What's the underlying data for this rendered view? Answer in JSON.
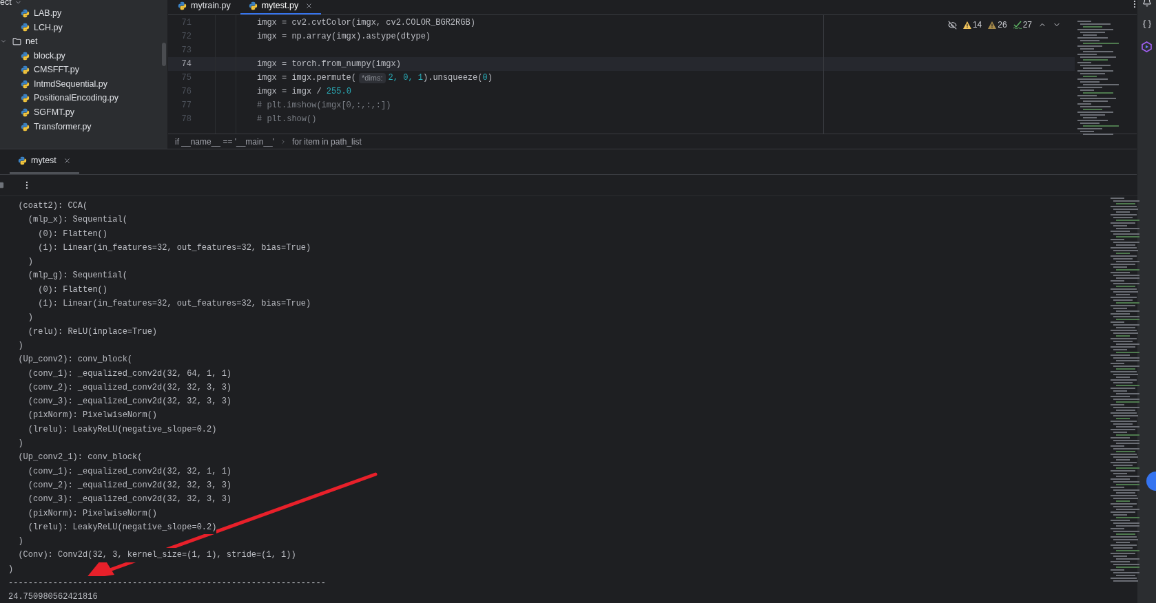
{
  "project_panel": {
    "header": "ect",
    "tree": [
      {
        "label": "LAB.py",
        "kind": "file"
      },
      {
        "label": "LCH.py",
        "kind": "file"
      },
      {
        "label": "net",
        "kind": "folder",
        "expanded": true,
        "children": [
          {
            "label": "block.py",
            "kind": "file"
          },
          {
            "label": "CMSFFT.py",
            "kind": "file"
          },
          {
            "label": "IntmdSequential.py",
            "kind": "file"
          },
          {
            "label": "PositionalEncoding.py",
            "kind": "file"
          },
          {
            "label": "SGFMT.py",
            "kind": "file"
          },
          {
            "label": "Transformer.py",
            "kind": "file"
          }
        ]
      }
    ]
  },
  "editor_tabs": [
    {
      "label": "mytrain.py",
      "selected": false
    },
    {
      "label": "mytest.py",
      "selected": true
    }
  ],
  "inspections": [
    {
      "kind": "warning",
      "count": "14"
    },
    {
      "kind": "weak_warning",
      "count": "26"
    },
    {
      "kind": "typo",
      "count": "27"
    }
  ],
  "code_lines": [
    {
      "number": "71",
      "current": false,
      "segments": [
        {
          "kind": "code",
          "text": "imgx = cv2.cvtColor(imgx, cv2.COLOR_BGR2RGB)"
        }
      ]
    },
    {
      "number": "72",
      "current": false,
      "segments": [
        {
          "kind": "code",
          "text": "imgx = np.array(imgx).astype(dtype)"
        }
      ]
    },
    {
      "number": "73",
      "current": false
    },
    {
      "number": "74",
      "current": true,
      "segments": [
        {
          "kind": "code",
          "text": "imgx = torch.from_numpy(imgx)"
        }
      ]
    },
    {
      "number": "75",
      "current": false,
      "segments": [
        {
          "kind": "code",
          "text": "imgx = imgx.permute("
        },
        {
          "kind": "hint",
          "text": "*dims:"
        },
        {
          "kind": "number",
          "text": "2, 0, 1"
        },
        {
          "kind": "code",
          "text": ").unsqueeze("
        },
        {
          "kind": "number",
          "text": "0"
        },
        {
          "kind": "code",
          "text": ")"
        }
      ]
    },
    {
      "number": "76",
      "current": false,
      "segments": [
        {
          "kind": "code",
          "text": "imgx = imgx / "
        },
        {
          "kind": "number",
          "text": "255.0"
        }
      ]
    },
    {
      "number": "77",
      "current": false,
      "segments": [
        {
          "kind": "comment",
          "text": "# plt.imshow(imgx[0,:,:,:])"
        }
      ]
    },
    {
      "number": "78",
      "current": false,
      "segments": [
        {
          "kind": "comment",
          "text": "# plt.show()"
        }
      ]
    }
  ],
  "breadcrumbs": [
    "if __name__ == '__main__'",
    "for item in path_list"
  ],
  "run_tabs": [
    {
      "label": "mytest",
      "selected": true
    }
  ],
  "console_lines": [
    "  (coatt2): CCA(",
    "    (mlp_x): Sequential(",
    "      (0): Flatten()",
    "      (1): Linear(in_features=32, out_features=32, bias=True)",
    "    )",
    "    (mlp_g): Sequential(",
    "      (0): Flatten()",
    "      (1): Linear(in_features=32, out_features=32, bias=True)",
    "    )",
    "    (relu): ReLU(inplace=True)",
    "  )",
    "  (Up_conv2): conv_block(",
    "    (conv_1): _equalized_conv2d(32, 64, 1, 1)",
    "    (conv_2): _equalized_conv2d(32, 32, 3, 3)",
    "    (conv_3): _equalized_conv2d(32, 32, 3, 3)",
    "    (pixNorm): PixelwiseNorm()",
    "    (lrelu): LeakyReLU(negative_slope=0.2)",
    "  )",
    "  (Up_conv2_1): conv_block(",
    "    (conv_1): _equalized_conv2d(32, 32, 1, 1)",
    "    (conv_2): _equalized_conv2d(32, 32, 3, 3)",
    "    (conv_3): _equalized_conv2d(32, 32, 3, 3)",
    "    (pixNorm): PixelwiseNorm()",
    "    (lrelu): LeakyReLU(negative_slope=0.2)",
    "  )",
    "  (Conv): Conv2d(32, 3, kernel_size=(1, 1), stride=(1, 1))",
    ")",
    "----------------------------------------------------------------",
    "24.750980562421816"
  ]
}
